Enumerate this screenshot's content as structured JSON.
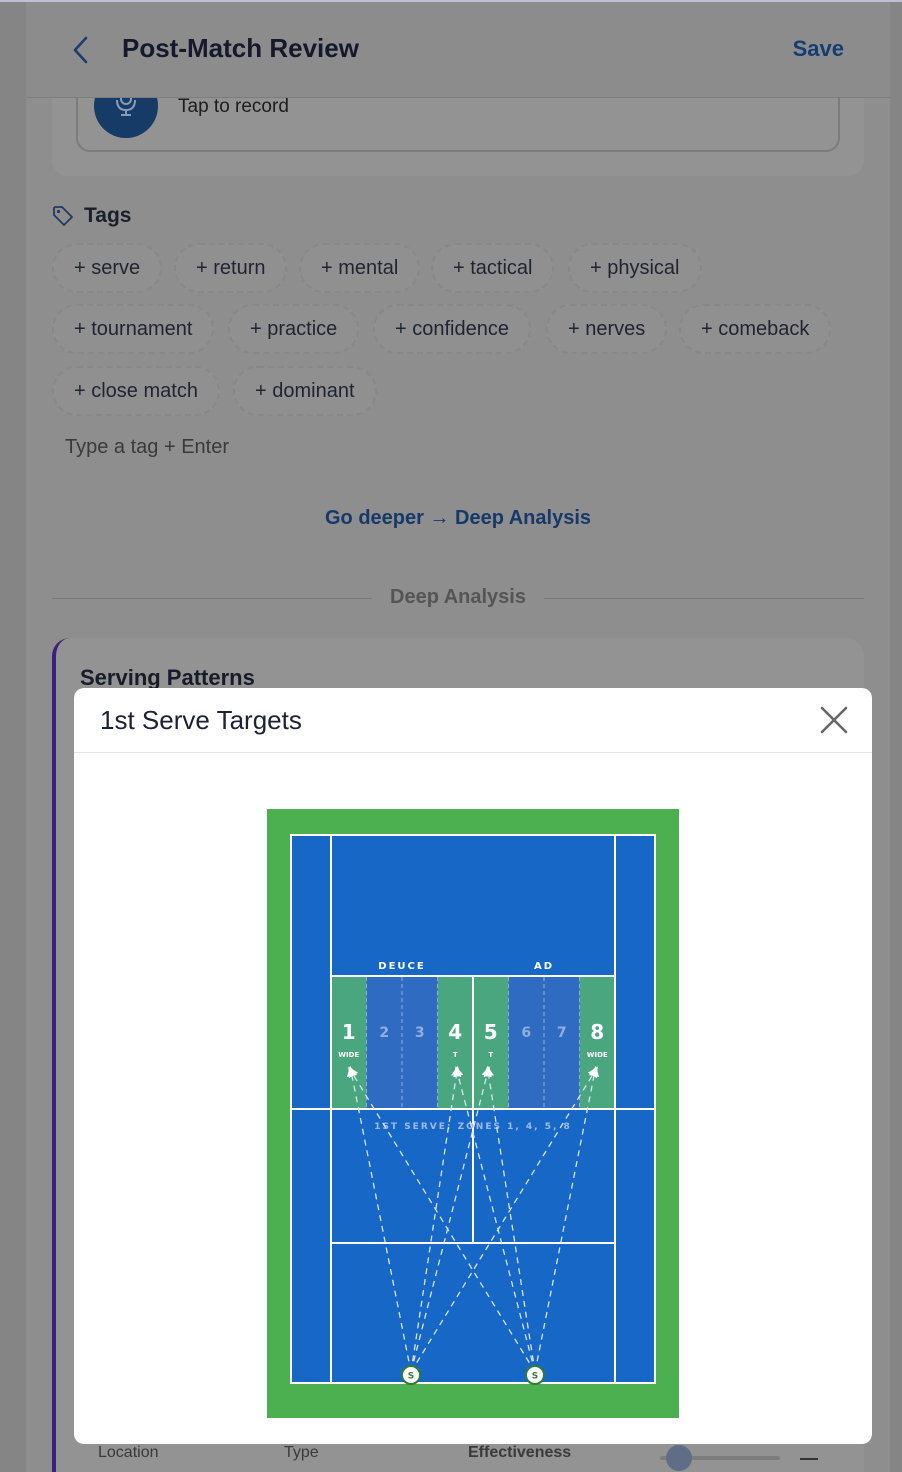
{
  "header": {
    "title": "Post-Match Review",
    "save_label": "Save"
  },
  "voice": {
    "record_label": "Tap to record"
  },
  "tags": {
    "title": "Tags",
    "chips": [
      "+ serve",
      "+ return",
      "+ mental",
      "+ tactical",
      "+ physical",
      "+ tournament",
      "+ practice",
      "+ confidence",
      "+ nerves",
      "+ comeback",
      "+ close match",
      "+ dominant"
    ],
    "input_placeholder": "Type a tag + Enter"
  },
  "go_deeper_link": "Go deeper → Deep Analysis",
  "section_divider": "Deep Analysis",
  "analysis_card": {
    "title": "Serving Patterns",
    "labels": {
      "location": "Location",
      "type": "Type",
      "effectiveness": "Effectiveness"
    }
  },
  "modal": {
    "title": "1st Serve Targets",
    "court": {
      "deuce_label": "DEUCE",
      "ad_label": "AD",
      "zones": [
        {
          "number": "1",
          "sub": "WIDE",
          "selected": true
        },
        {
          "number": "2",
          "sub": "",
          "selected": false
        },
        {
          "number": "3",
          "sub": "",
          "selected": false
        },
        {
          "number": "4",
          "sub": "T",
          "selected": true
        },
        {
          "number": "5",
          "sub": "T",
          "selected": true
        },
        {
          "number": "6",
          "sub": "",
          "selected": false
        },
        {
          "number": "7",
          "sub": "",
          "selected": false
        },
        {
          "number": "8",
          "sub": "WIDE",
          "selected": true
        }
      ],
      "summary": "1ST SERVE: ZONES 1, 4, 5, 8",
      "server_marker": "S"
    }
  },
  "colors": {
    "surround": "#4caf50",
    "court": "#1767c6",
    "zone_selected": "#4aa67f",
    "zone_default": "#2f6bc0",
    "brand": "#1b4f8f"
  }
}
